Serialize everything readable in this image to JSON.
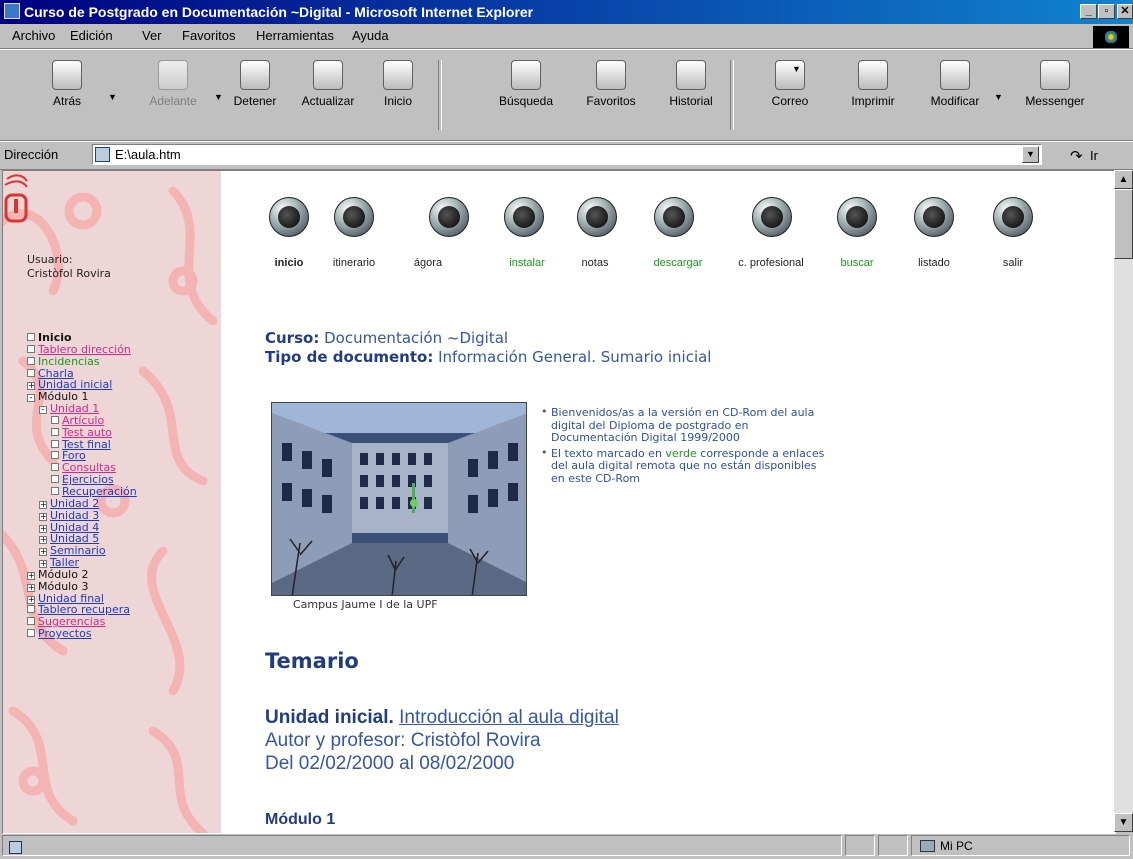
{
  "window": {
    "title": "Curso de Postgrado en Documentación ~Digital - Microsoft Internet Explorer",
    "controls": [
      "_",
      "▫",
      "✕"
    ]
  },
  "menu": [
    "Archivo",
    "Edición",
    "Ver",
    "Favoritos",
    "Herramientas",
    "Ayuda"
  ],
  "toolbar": [
    {
      "label": "Atrás",
      "icon": "back-arrow-icon",
      "enabled": true
    },
    {
      "label": "Adelante",
      "icon": "forward-arrow-icon",
      "enabled": false
    },
    {
      "label": "Detener",
      "icon": "stop-icon",
      "enabled": true
    },
    {
      "label": "Actualizar",
      "icon": "refresh-icon",
      "enabled": true
    },
    {
      "label": "Inicio",
      "icon": "home-icon",
      "enabled": true
    },
    {
      "label": "Búsqueda",
      "icon": "search-icon",
      "enabled": true
    },
    {
      "label": "Favoritos",
      "icon": "favorites-icon",
      "enabled": true
    },
    {
      "label": "Historial",
      "icon": "history-icon",
      "enabled": true
    },
    {
      "label": "Correo",
      "icon": "mail-icon",
      "enabled": true
    },
    {
      "label": "Imprimir",
      "icon": "print-icon",
      "enabled": true
    },
    {
      "label": "Modificar",
      "icon": "edit-icon",
      "enabled": true
    },
    {
      "label": "Messenger",
      "icon": "messenger-icon",
      "enabled": true
    }
  ],
  "address": {
    "label": "Dirección",
    "value": "E:\\aula.htm",
    "go": "Ir"
  },
  "sidebar": {
    "user_label": "Usuario:",
    "user_name": "Cristòfol Rovira",
    "items": [
      {
        "label": "Inicio",
        "box": "",
        "indent": 0,
        "style": "dark bold"
      },
      {
        "label": "Tablero dirección",
        "box": "",
        "indent": 0,
        "style": "pink"
      },
      {
        "label": "Incidencias",
        "box": "",
        "indent": 0,
        "style": "green"
      },
      {
        "label": "Charla",
        "box": "",
        "indent": 0,
        "style": ""
      },
      {
        "label": "Unidad inicial",
        "box": "+",
        "indent": 0,
        "style": ""
      },
      {
        "label": "Módulo 1",
        "box": "−",
        "indent": 0,
        "style": "dark"
      },
      {
        "label": "Unidad 1",
        "box": "−",
        "indent": 1,
        "style": "pink"
      },
      {
        "label": "Artículo",
        "box": "",
        "indent": 2,
        "style": "pink"
      },
      {
        "label": "Test auto",
        "box": "",
        "indent": 2,
        "style": "pink"
      },
      {
        "label": "Test final",
        "box": "",
        "indent": 2,
        "style": ""
      },
      {
        "label": "Foro",
        "box": "",
        "indent": 2,
        "style": ""
      },
      {
        "label": "Consultas",
        "box": "",
        "indent": 2,
        "style": "pink"
      },
      {
        "label": "Ejercicios",
        "box": "",
        "indent": 2,
        "style": ""
      },
      {
        "label": "Recuperación",
        "box": "",
        "indent": 2,
        "style": ""
      },
      {
        "label": "Unidad 2",
        "box": "+",
        "indent": 1,
        "style": ""
      },
      {
        "label": "Unidad 3",
        "box": "+",
        "indent": 1,
        "style": ""
      },
      {
        "label": "Unidad 4",
        "box": "+",
        "indent": 1,
        "style": ""
      },
      {
        "label": "Unidad 5",
        "box": "+",
        "indent": 1,
        "style": ""
      },
      {
        "label": "Seminario",
        "box": "+",
        "indent": 1,
        "style": ""
      },
      {
        "label": "Taller",
        "box": "+",
        "indent": 1,
        "style": ""
      },
      {
        "label": "Módulo 2",
        "box": "+",
        "indent": 0,
        "style": "dark"
      },
      {
        "label": "Módulo 3",
        "box": "+",
        "indent": 0,
        "style": "dark"
      },
      {
        "label": "Unidad final",
        "box": "+",
        "indent": 0,
        "style": ""
      },
      {
        "label": "Tablero recupera",
        "box": "",
        "indent": 0,
        "style": ""
      },
      {
        "label": "Sugerencias",
        "box": "",
        "indent": 0,
        "style": "pink"
      },
      {
        "label": "Proyectos",
        "box": "",
        "indent": 0,
        "style": ""
      }
    ]
  },
  "nav": [
    {
      "label": "inicio",
      "icon": "home-icon",
      "color": "dark"
    },
    {
      "label": "itinerario",
      "icon": "itinerary-icon",
      "color": "dark"
    },
    {
      "label": "ágora",
      "icon": "agora-icon",
      "color": "dark"
    },
    {
      "label": "instalar",
      "icon": "install-icon",
      "color": "green"
    },
    {
      "label": "notas",
      "icon": "notes-icon",
      "color": "dark"
    },
    {
      "label": "descargar",
      "icon": "download-icon",
      "color": "green"
    },
    {
      "label": "c. profesional",
      "icon": "book-icon",
      "color": "dark"
    },
    {
      "label": "buscar",
      "icon": "search-icon",
      "color": "green"
    },
    {
      "label": "listado",
      "icon": "list-icon",
      "color": "dark"
    },
    {
      "label": "salir",
      "icon": "exit-door-icon",
      "color": "dark"
    }
  ],
  "main": {
    "curso_label": "Curso:",
    "curso_value": "Documentación ~Digital",
    "tipo_label": "Tipo de documento:",
    "tipo_value": "Información General. Sumario inicial",
    "photo_caption": "Campus Jaume I de la UPF",
    "bullet1": "Bienvenidos/as a la versión en CD-Rom del aula digital del Diploma de postgrado en Documentación Digital 1999/2000",
    "bullet2_pre": "El texto marcado en ",
    "bullet2_green": "verde",
    "bullet2_post": " corresponde a enlaces del aula digital remota que no están disponibles en este CD-Rom",
    "temario": "Temario",
    "unidad_title": "Unidad inicial.",
    "unidad_link": "Introducción al aula digital",
    "unidad_autor": "Autor y profesor: Cristòfol Rovira",
    "unidad_fechas": "Del 02/02/2000 al 08/02/2000",
    "modulo": "Módulo 1"
  },
  "status": {
    "zone": "Mi PC"
  }
}
